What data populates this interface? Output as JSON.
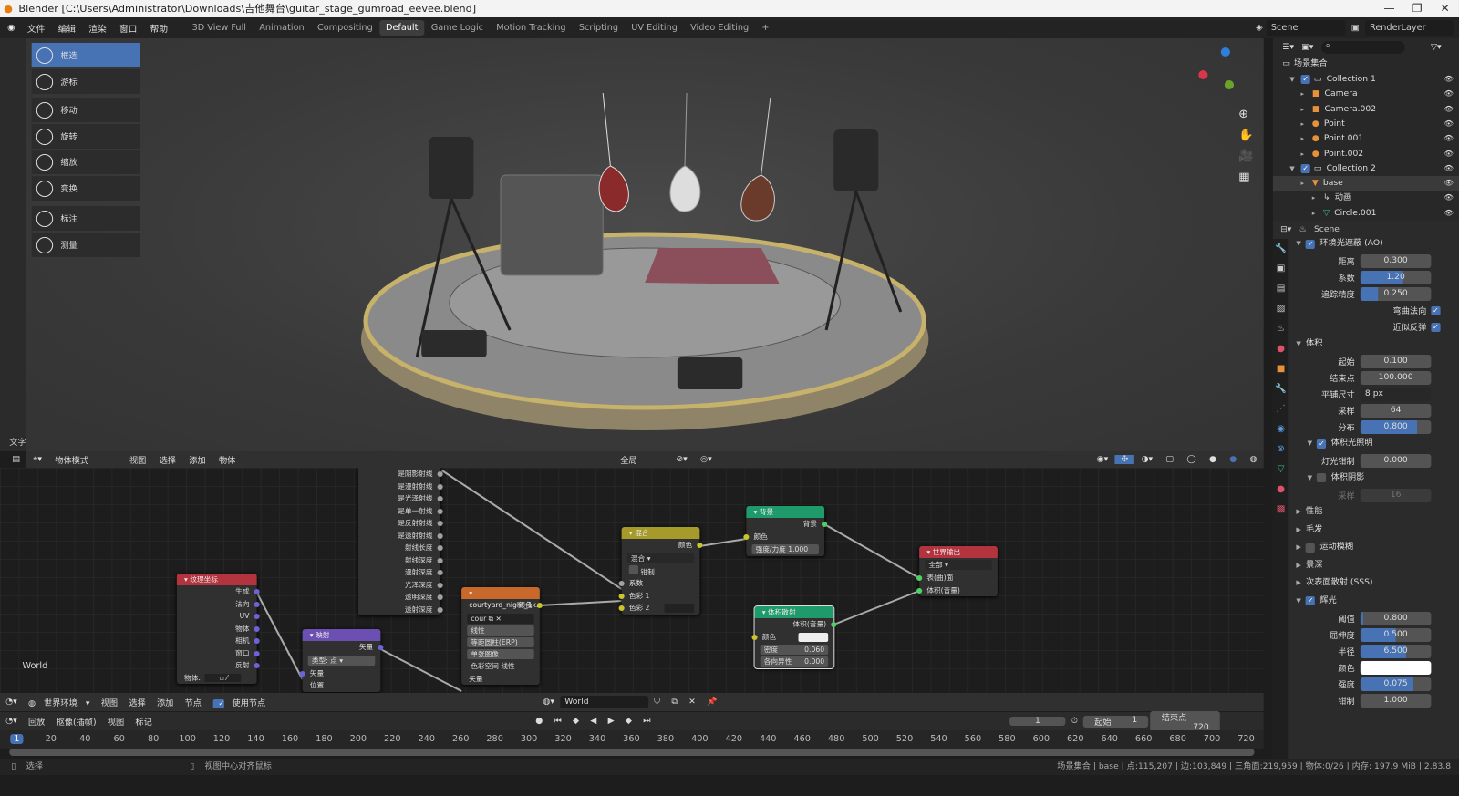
{
  "window": {
    "title": "Blender [C:\\Users\\Administrator\\Downloads\\吉他舞台\\guitar_stage_gumroad_eevee.blend]"
  },
  "topbar": {
    "menus": [
      "文件",
      "编辑",
      "渲染",
      "窗口",
      "帮助"
    ],
    "workspaces": [
      "3D View Full",
      "Animation",
      "Compositing",
      "Default",
      "Game Logic",
      "Motion Tracking",
      "Scripting",
      "UV Editing",
      "Video Editing",
      "+"
    ],
    "active_workspace": "Default",
    "scene": "Scene",
    "view_layer": "RenderLayer"
  },
  "toolbar": {
    "tools": [
      "框选",
      "游标",
      "移动",
      "旋转",
      "缩放",
      "变换",
      "标注",
      "测量"
    ],
    "active": "框选"
  },
  "viewport": {
    "side_label": "文字",
    "mode": "物体模式",
    "menus": [
      "视图",
      "选择",
      "添加",
      "物体"
    ],
    "orientation": "全局"
  },
  "outliner": {
    "root": "场景集合",
    "items": [
      {
        "label": "Collection 1",
        "icon": "collection-icon",
        "depth": 0,
        "check": true
      },
      {
        "label": "Camera",
        "icon": "camera-icon",
        "depth": 1
      },
      {
        "label": "Camera.002",
        "icon": "camera-icon",
        "depth": 1
      },
      {
        "label": "Point",
        "icon": "light-icon",
        "depth": 1
      },
      {
        "label": "Point.001",
        "icon": "light-icon",
        "depth": 1
      },
      {
        "label": "Point.002",
        "icon": "light-icon",
        "depth": 1
      },
      {
        "label": "Collection 2",
        "icon": "collection-icon",
        "depth": 0,
        "check": true
      },
      {
        "label": "base",
        "icon": "mesh-object-icon",
        "depth": 1,
        "selected": true
      },
      {
        "label": "动画",
        "icon": "animation-icon",
        "depth": 2
      },
      {
        "label": "Circle.001",
        "icon": "mesh-data-icon",
        "depth": 2
      }
    ]
  },
  "properties": {
    "context": "Scene",
    "items": [
      {
        "kind": "header",
        "label": "环境光遮蔽 (AO)",
        "check": true,
        "open": true
      },
      {
        "kind": "field",
        "label": "距离",
        "value": "0.300",
        "fill": 0
      },
      {
        "kind": "field",
        "label": "系数",
        "value": "1.20",
        "fill": 0.6
      },
      {
        "kind": "field",
        "label": "追踪精度",
        "value": "0.250",
        "fill": 0.25
      },
      {
        "kind": "check",
        "label": "弯曲法向",
        "check": true
      },
      {
        "kind": "check",
        "label": "近似反弹",
        "check": true
      },
      {
        "kind": "header",
        "label": "体积",
        "open": true
      },
      {
        "kind": "field",
        "label": "起始",
        "value": "0.100",
        "fill": 0
      },
      {
        "kind": "field",
        "label": "结束点",
        "value": "100.000",
        "fill": 0
      },
      {
        "kind": "select",
        "label": "平铺尺寸",
        "value": "8 px"
      },
      {
        "kind": "field",
        "label": "采样",
        "value": "64",
        "fill": 0
      },
      {
        "kind": "field",
        "label": "分布",
        "value": "0.800",
        "fill": 0.8
      },
      {
        "kind": "sub",
        "label": "体积光照明",
        "check": true
      },
      {
        "kind": "field",
        "label": "灯光钳制",
        "value": "0.000",
        "fill": 0
      },
      {
        "kind": "sub",
        "label": "体积阴影",
        "check": false
      },
      {
        "kind": "field",
        "label": "采样",
        "value": "16",
        "fill": 0,
        "disabled": true
      },
      {
        "kind": "header",
        "label": "性能",
        "open": false
      },
      {
        "kind": "header",
        "label": "毛发",
        "open": false
      },
      {
        "kind": "header",
        "label": "运动模糊",
        "check": false,
        "open": false
      },
      {
        "kind": "header",
        "label": "景深",
        "open": false
      },
      {
        "kind": "header",
        "label": "次表面散射 (SSS)",
        "open": false
      },
      {
        "kind": "header",
        "label": "辉光",
        "check": true,
        "open": true
      },
      {
        "kind": "field",
        "label": "阈值",
        "value": "0.800",
        "fill": 0.04
      },
      {
        "kind": "field",
        "label": "屈伸度",
        "value": "0.500",
        "fill": 0.5
      },
      {
        "kind": "field",
        "label": "半径",
        "value": "6.500",
        "fill": 0.65
      },
      {
        "kind": "color",
        "label": "颜色",
        "color": "#ffffff"
      },
      {
        "kind": "field",
        "label": "强度",
        "value": "0.075",
        "fill": 0.75
      },
      {
        "kind": "field",
        "label": "钳制",
        "value": "1.000",
        "fill": 0
      }
    ]
  },
  "node_editor": {
    "type": "世界环境",
    "menus": [
      "视图",
      "选择",
      "添加",
      "节点"
    ],
    "use_nodes_label": "使用节点",
    "use_nodes": true,
    "world": "World",
    "world_label": "World",
    "nodes": {
      "light_path": {
        "outputs": [
          "是阴影射线",
          "是漫射射线",
          "是光泽射线",
          "是单一射线",
          "是反射射线",
          "是透射射线",
          "射线长度",
          "射线深度",
          "漫射深度",
          "光泽深度",
          "透明深度",
          "透射深度"
        ]
      },
      "tex_coord": {
        "title": "纹理坐标",
        "outputs": [
          "生成",
          "法向",
          "UV",
          "物体",
          "相机",
          "窗口",
          "反射"
        ],
        "object_label": "物体:"
      },
      "mapping": {
        "title": "映射",
        "output": "矢量",
        "type_label": "类型:",
        "type_value": "点",
        "inputs": [
          "矢量",
          "位置"
        ]
      },
      "env_tex": {
        "title": "courtyard_night_1k.",
        "output": "颜色",
        "image": "cour",
        "interp": "线性",
        "proj": "等距圆柱(ERP)",
        "source": "单张图像",
        "cs_label": "色彩空间",
        "cs_value": "线性",
        "input": "矢量"
      },
      "mix": {
        "title": "混合",
        "output": "颜色",
        "blend": "混合",
        "clamp": "钳制",
        "inputs": [
          "系数",
          "色彩 1",
          "色彩 2"
        ]
      },
      "background": {
        "title": "背景",
        "output": "背景",
        "color": "颜色",
        "strength_label": "强度/力度",
        "strength": "1.000"
      },
      "vol_scatter": {
        "title": "体积散射",
        "output": "体积(音量)",
        "color": "颜色",
        "density_label": "密度",
        "density": "0.060",
        "aniso_label": "各向异性",
        "aniso": "0.000"
      },
      "world_output": {
        "title": "世界输出",
        "target": "全部",
        "inputs": [
          "表(曲)面",
          "体积(音量)"
        ]
      }
    }
  },
  "timeline": {
    "menus": [
      "回放",
      "抠像(插帧)",
      "视图",
      "标记"
    ],
    "current_frame": "1",
    "start_label": "起始",
    "start": "1",
    "end_label": "结束点",
    "end": "720",
    "ticks": [
      "1",
      "20",
      "40",
      "60",
      "80",
      "100",
      "120",
      "140",
      "160",
      "180",
      "200",
      "220",
      "240",
      "260",
      "280",
      "300",
      "320",
      "340",
      "360",
      "380",
      "400",
      "420",
      "440",
      "460",
      "480",
      "500",
      "520",
      "540",
      "560",
      "580",
      "600",
      "620",
      "640",
      "660",
      "680",
      "700",
      "720"
    ]
  },
  "status": {
    "left": "选择",
    "middle": "视图中心对齐鼠标",
    "right": "场景集合 | base | 点:115,207 | 边:103,849 | 三角面:219,959 | 物体:0/26 | 内存: 197.9 MiB | 2.83.8"
  },
  "colors": {
    "accent": "#4772b3",
    "header_texture": "#b3343f",
    "header_vector": "#6c4fb3",
    "header_image": "#c8682a",
    "header_color": "#a59a2a",
    "header_shader": "#1f9a6a",
    "header_output": "#b3343f"
  }
}
